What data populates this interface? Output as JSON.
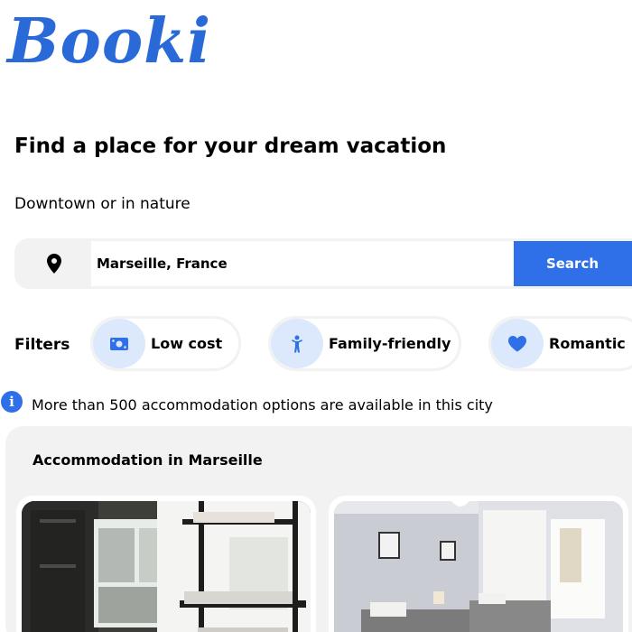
{
  "logo": {
    "text": "Booki"
  },
  "page_title": "Find a place for your dream vacation",
  "subtitle": "Downtown or in nature",
  "search": {
    "value": "Marseille, France",
    "button_label": "Search",
    "pin_icon": "map-pin-icon"
  },
  "filters": {
    "label": "Filters",
    "items": [
      {
        "label": "Low cost",
        "icon": "money-icon"
      },
      {
        "label": "Family-friendly",
        "icon": "child-icon"
      },
      {
        "label": "Romantic",
        "icon": "heart-icon"
      }
    ]
  },
  "info": {
    "text": "More than 500 accommodation options are available in this city",
    "icon": "info-icon"
  },
  "accommodation": {
    "title": "Accommodation in Marseille"
  },
  "colors": {
    "brand": "#2a6ad8",
    "accent": "#2f6fe8",
    "chip_bg": "#dce8fc",
    "panel_bg": "#f2f2f2"
  }
}
